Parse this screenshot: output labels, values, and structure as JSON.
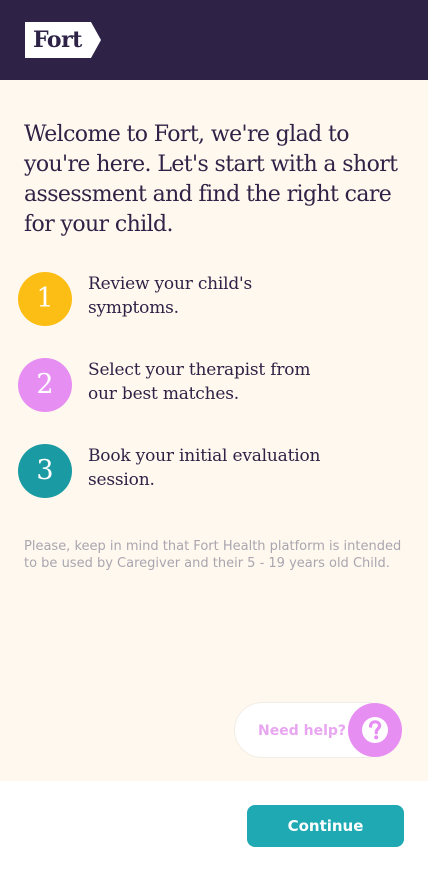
{
  "header": {
    "logo_text": "Fort",
    "background": "#2e2346"
  },
  "intro": {
    "headline": "Welcome to Fort, we're glad to you're here. Let's start with a short assessment and find the right care for your child."
  },
  "steps": [
    {
      "number": "1",
      "text": "Review your child's symptoms.",
      "color": "#fcbd14"
    },
    {
      "number": "2",
      "text": "Select your therapist from our best matches.",
      "color": "#e78ef2"
    },
    {
      "number": "3",
      "text": "Book your initial evaluation session.",
      "color": "#1a9ba3"
    }
  ],
  "disclaimer": "Please, keep in mind that Fort Health platform is intended to be used by Caregiver and their 5 - 19 years old Child.",
  "help": {
    "label": "Need help?",
    "icon": "question-circle-icon",
    "color": "#e78ef2"
  },
  "footer": {
    "continue_label": "Continue",
    "accent": "#1fa9b3"
  }
}
